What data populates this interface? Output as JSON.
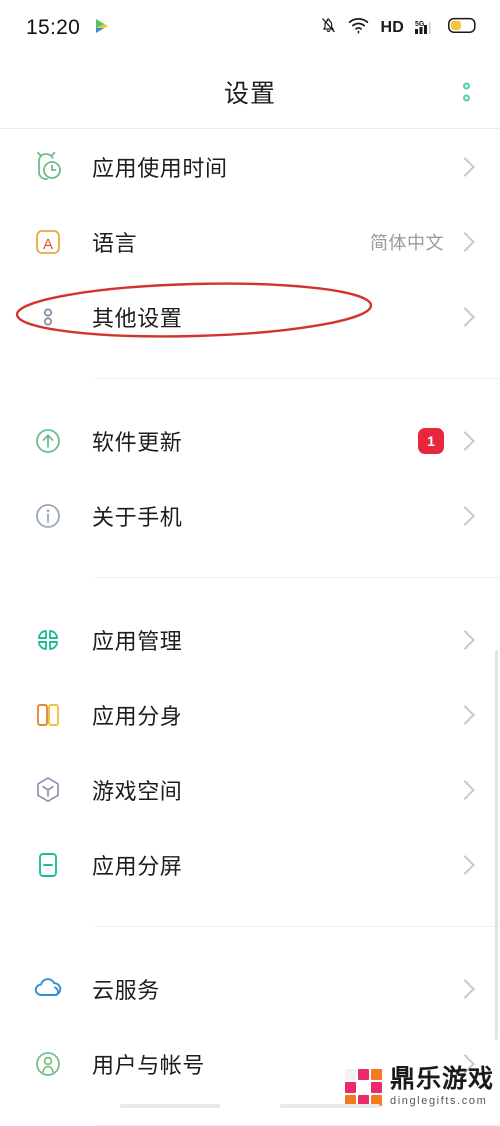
{
  "status_bar": {
    "time": "15:20",
    "left_icons": [
      {
        "name": "play-store-icon"
      }
    ],
    "right_icons": [
      {
        "name": "notifications-off-icon"
      },
      {
        "name": "wifi-icon"
      },
      {
        "name": "hd-icon",
        "label": "HD"
      },
      {
        "name": "signal-5g-icon",
        "label": "5G"
      },
      {
        "name": "battery-icon"
      }
    ]
  },
  "header": {
    "title": "设置",
    "menu_icon": "more-options-icon"
  },
  "highlight": {
    "annotation_shape": "ellipse",
    "color": "#d93025",
    "target_label": "其他设置"
  },
  "colors": {
    "accent_green": "#4fd69c",
    "badge_red": "#e8273f",
    "annotation_red": "#d0342c",
    "chevron_grey": "#c8c8c8",
    "value_grey": "#9b9b9b"
  },
  "groups": [
    {
      "items": [
        {
          "label": "应用使用时间",
          "icon": "alarm-clock-icon",
          "value": "",
          "badge": ""
        },
        {
          "label": "语言",
          "icon": "language-a-icon",
          "value": "简体中文",
          "badge": ""
        },
        {
          "label": "其他设置",
          "icon": "more-dots-icon",
          "value": "",
          "badge": ""
        }
      ]
    },
    {
      "items": [
        {
          "label": "软件更新",
          "icon": "software-update-icon",
          "value": "",
          "badge": "1"
        },
        {
          "label": "关于手机",
          "icon": "info-icon",
          "value": "",
          "badge": ""
        }
      ]
    },
    {
      "items": [
        {
          "label": "应用管理",
          "icon": "app-management-icon",
          "value": "",
          "badge": ""
        },
        {
          "label": "应用分身",
          "icon": "app-clone-icon",
          "value": "",
          "badge": ""
        },
        {
          "label": "游戏空间",
          "icon": "game-space-icon",
          "value": "",
          "badge": ""
        },
        {
          "label": "应用分屏",
          "icon": "split-screen-icon",
          "value": "",
          "badge": ""
        }
      ]
    },
    {
      "items": [
        {
          "label": "云服务",
          "icon": "cloud-service-icon",
          "value": "",
          "badge": ""
        },
        {
          "label": "用户与帐号",
          "icon": "user-account-icon",
          "value": "",
          "badge": ""
        }
      ]
    }
  ],
  "watermark": {
    "brand_cn": "鼎乐游戏",
    "brand_url": "dinglegifts.com"
  }
}
